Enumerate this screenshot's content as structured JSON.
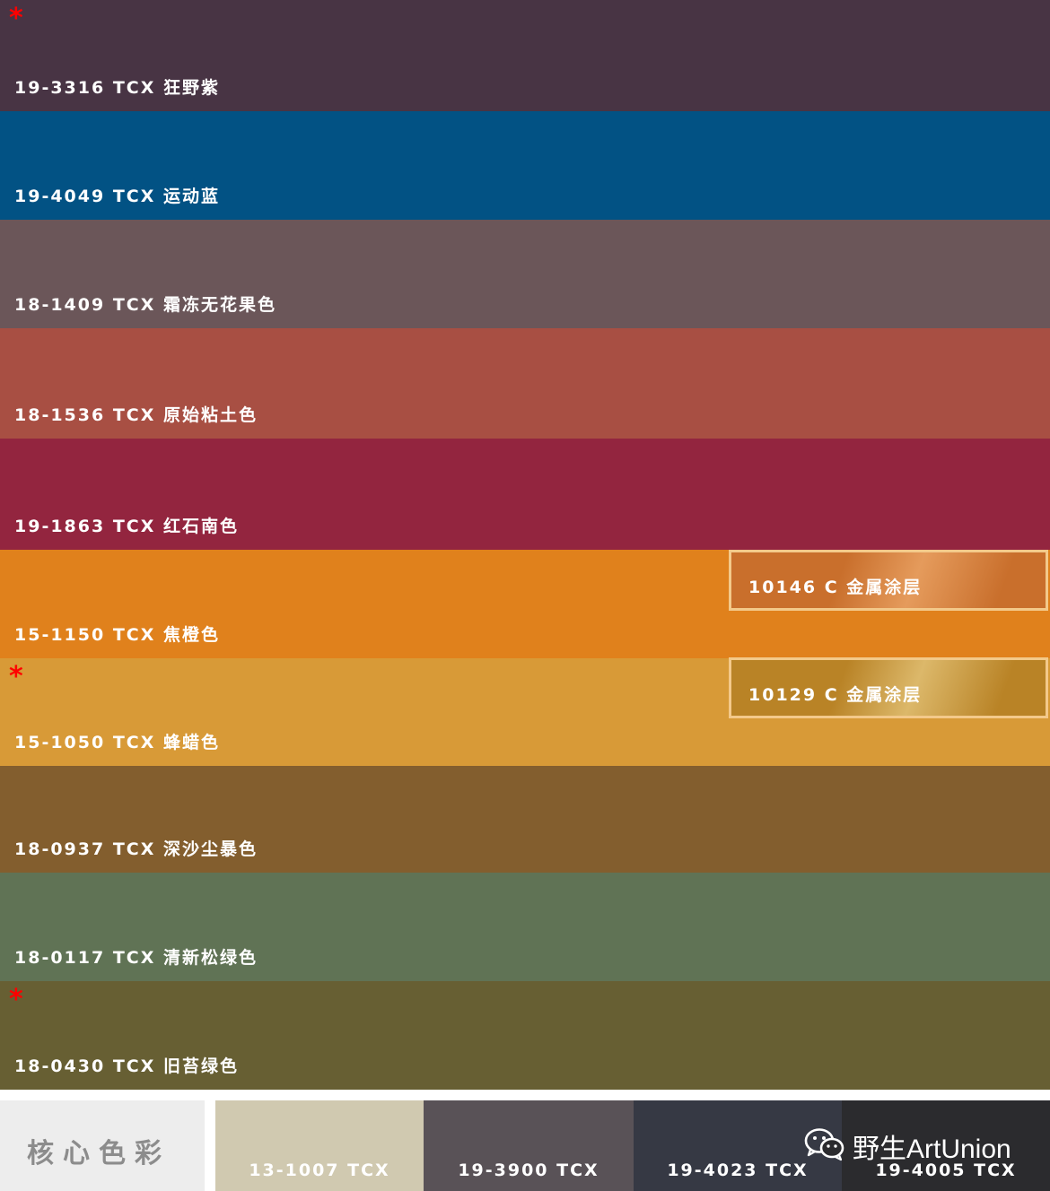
{
  "stripes": [
    {
      "code": "19-3316 TCX 狂野紫",
      "color": "#483444",
      "star": "*"
    },
    {
      "code": "19-4049 TCX 运动蓝",
      "color": "#025284",
      "star": ""
    },
    {
      "code": "18-1409 TCX 霜冻无花果色",
      "color": "#6b5659",
      "star": ""
    },
    {
      "code": "18-1536 TCX 原始粘土色",
      "color": "#a84f43",
      "star": ""
    },
    {
      "code": "19-1863 TCX 红石南色",
      "color": "#93253f",
      "star": ""
    },
    {
      "code": "15-1150 TCX 焦橙色",
      "color": "#e0811c",
      "star": ""
    },
    {
      "code": "15-1050 TCX 蜂蜡色",
      "color": "#d89a37",
      "star": "*"
    },
    {
      "code": "18-0937 TCX 深沙尘暴色",
      "color": "#835e2e",
      "star": ""
    },
    {
      "code": "18-0117 TCX 清新松绿色",
      "color": "#607355",
      "star": ""
    },
    {
      "code": "18-0430 TCX 旧苔绿色",
      "color": "#675f33",
      "star": "*"
    }
  ],
  "metallics": [
    {
      "label": "10146 C 金属涂层",
      "color": "#c96f2c",
      "highlight": "#e59b5c"
    },
    {
      "label": "10129 C 金属涂层",
      "color": "#b98326",
      "highlight": "#dcb86a"
    }
  ],
  "core": {
    "title": "核心色彩",
    "swatches": [
      {
        "code": "13-1007 TCX",
        "color": "#d0c9b0"
      },
      {
        "code": "19-3900 TCX",
        "color": "#595257"
      },
      {
        "code": "19-4023 TCX",
        "color": "#363944"
      },
      {
        "code": "19-4005 TCX",
        "color": "#2b2b2e"
      }
    ]
  },
  "watermark": {
    "text": "野生ArtUnion",
    "icon": "wechat-icon"
  }
}
